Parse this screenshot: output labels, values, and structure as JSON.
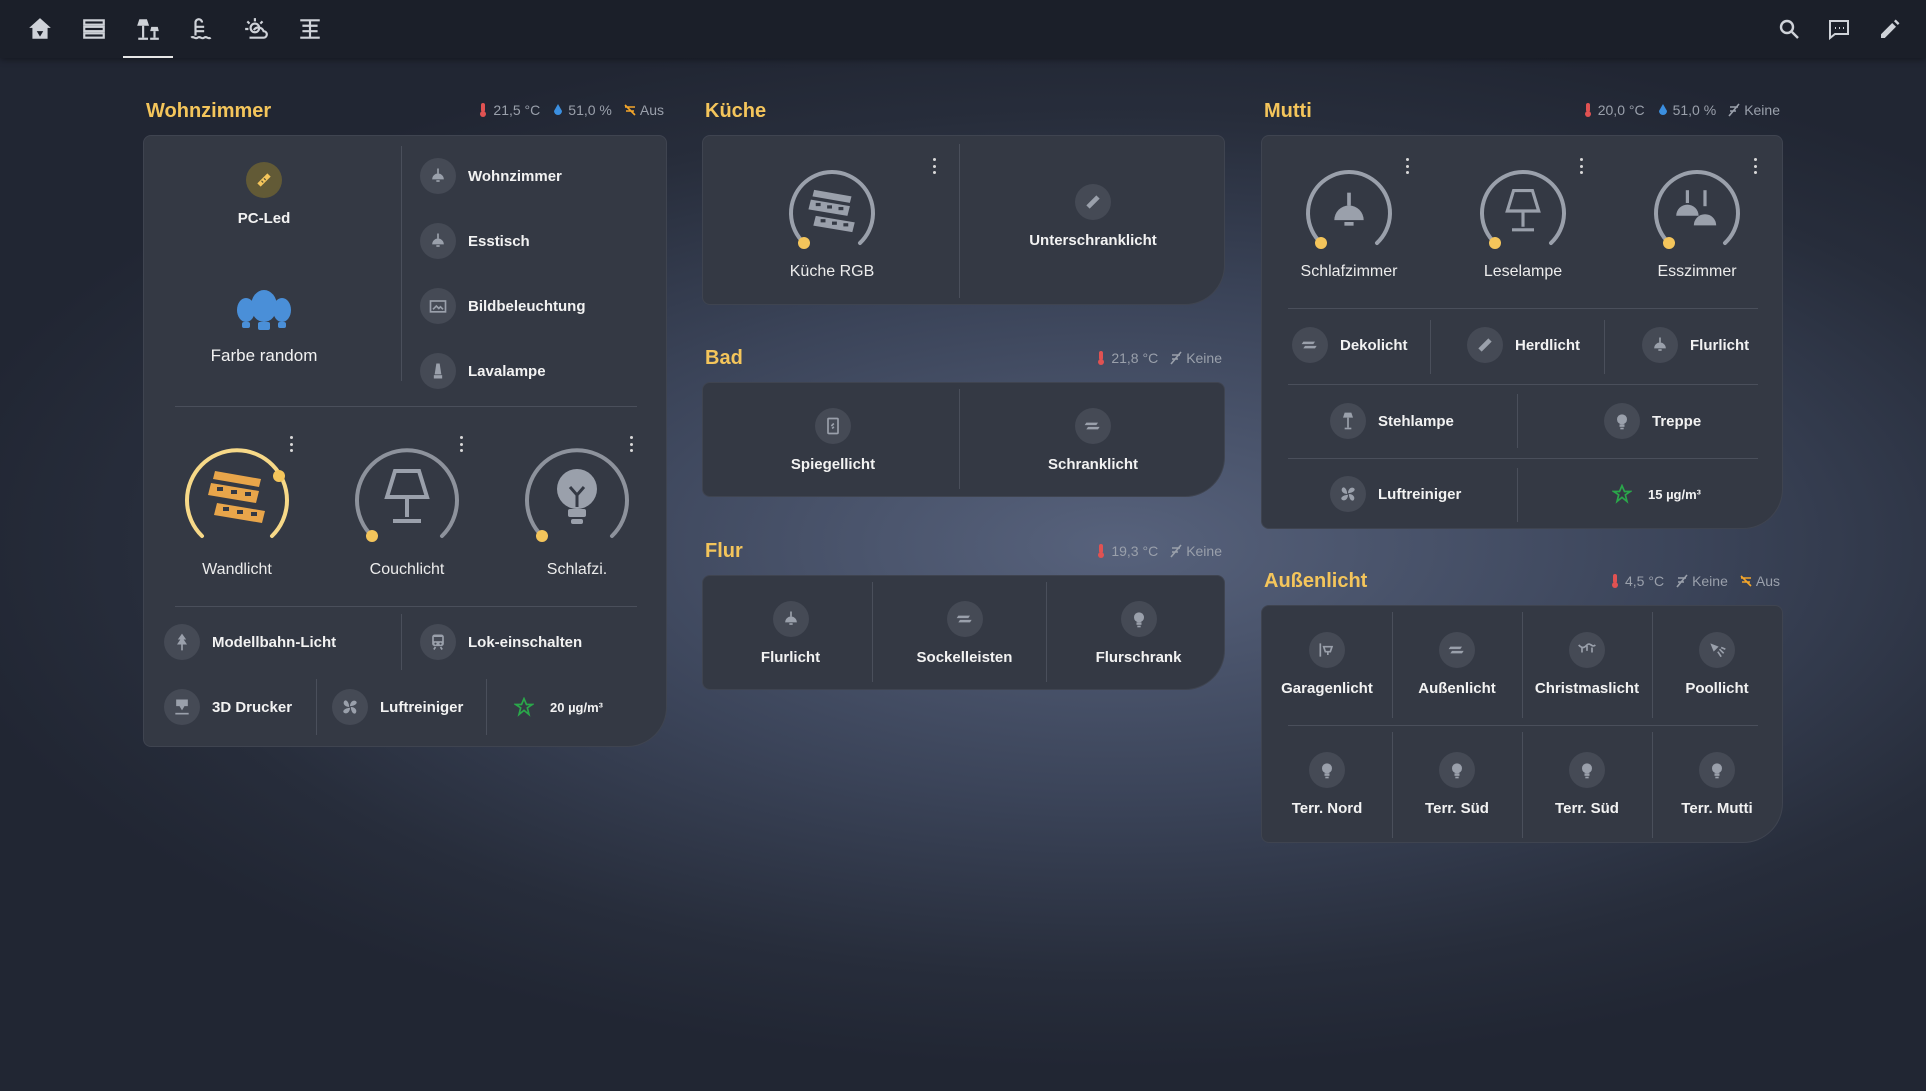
{
  "colors": {
    "accent": "#f4c55b",
    "bar": "#1b1f29",
    "card": "#343944",
    "temp_red": "#e05252",
    "humid_blue": "#3b8fe0",
    "window_orange": "#f4a62a",
    "air_green": "#2aa84a",
    "lamp_on": "#e8a54a",
    "random_blue": "#4a8fd8"
  },
  "topbar": {
    "tabs": [
      {
        "icon": "home-icon"
      },
      {
        "icon": "list-icon"
      },
      {
        "icon": "lamps-icon"
      },
      {
        "icon": "water-heater-icon"
      },
      {
        "icon": "weather-icon"
      },
      {
        "icon": "skylight-icon"
      }
    ],
    "active_tab": 2,
    "right": [
      {
        "icon": "search-icon"
      },
      {
        "icon": "chat-icon"
      },
      {
        "icon": "pencil-icon"
      }
    ]
  },
  "wohnzimmer": {
    "title": "Wohnzimmer",
    "temp": "21,5 °C",
    "humidity": "51,0 %",
    "window": "Aus",
    "pcled": "PC-Led",
    "farbe": "Farbe random",
    "list": [
      "Wohnzimmer",
      "Esstisch",
      "Bildbeleuchtung",
      "Lavalampe"
    ],
    "dials": [
      "Wandlicht",
      "Couchlicht",
      "Schlafzi."
    ],
    "modellbahn": "Modellbahn-Licht",
    "lok": "Lok-einschalten",
    "drucker": "3D Drucker",
    "luftreiniger": "Luftreiniger",
    "pm": "20 µg/m³"
  },
  "kueche": {
    "title": "Küche",
    "dial": "Küche RGB",
    "unterschrank": "Unterschranklicht"
  },
  "bad": {
    "title": "Bad",
    "temp": "21,8 °C",
    "window": "Keine",
    "items": [
      "Spiegellicht",
      "Schranklicht"
    ]
  },
  "flur": {
    "title": "Flur",
    "temp": "19,3 °C",
    "window": "Keine",
    "items": [
      "Flurlicht",
      "Sockelleisten",
      "Flurschrank"
    ]
  },
  "mutti": {
    "title": "Mutti",
    "temp": "20,0 °C",
    "humidity": "51,0 %",
    "window": "Keine",
    "dials": [
      "Schlafzimmer",
      "Leselampe",
      "Esszimmer"
    ],
    "row1": [
      "Dekolicht",
      "Herdlicht",
      "Flurlicht"
    ],
    "row2": [
      "Stehlampe",
      "Treppe"
    ],
    "luftreiniger": "Luftreiniger",
    "pm": "15 µg/m³"
  },
  "aussen": {
    "title": "Außenlicht",
    "temp": "4,5 °C",
    "window": "Keine",
    "window2": "Aus",
    "row1": [
      "Garagenlicht",
      "Außenlicht",
      "Christmaslicht",
      "Poollicht"
    ],
    "row2": [
      "Terr. Nord",
      "Terr. Süd",
      "Terr. Süd",
      "Terr. Mutti"
    ]
  }
}
